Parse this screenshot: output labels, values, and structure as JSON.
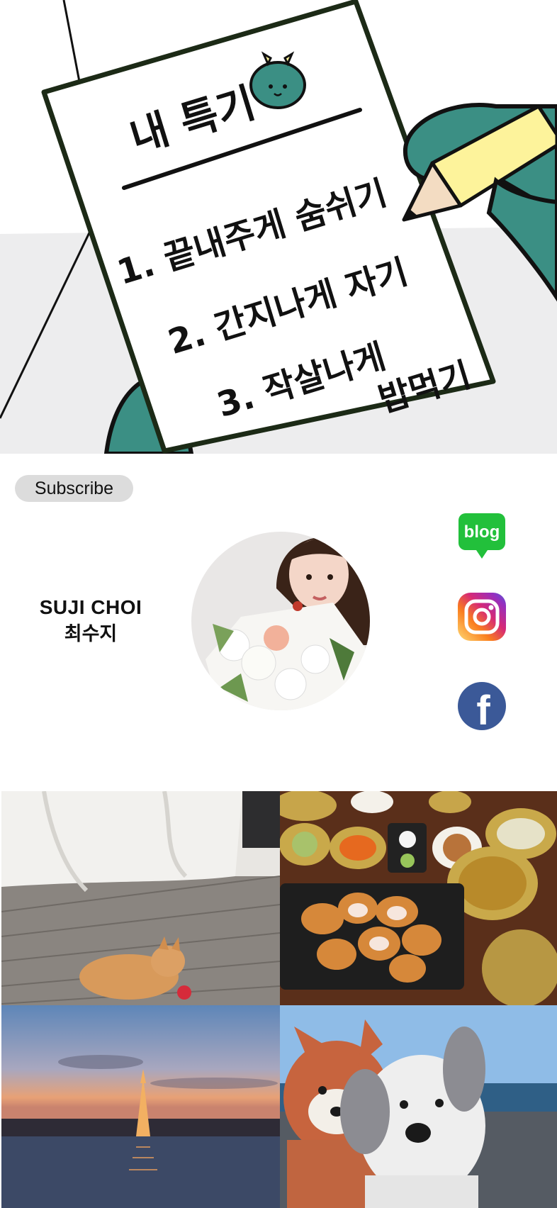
{
  "hero": {
    "note_title": "내 특기",
    "note_items": [
      "1. 끝내주게 숨쉬기",
      "2. 간지나게 자기",
      "3. 작살나게",
      "밥먹기"
    ]
  },
  "subscribe_label": "Subscribe",
  "profile": {
    "name_en": "SUJI CHOI",
    "name_ko": "최수지"
  },
  "social": {
    "blog_label": "blog",
    "facebook_letter": "f"
  },
  "colors": {
    "dragon_teal": "#3b8f84",
    "pencil_yellow": "#fdf39b",
    "blog_green": "#22c03b",
    "facebook_blue": "#3b5998",
    "subscribe_bg": "#dcdcdc"
  }
}
